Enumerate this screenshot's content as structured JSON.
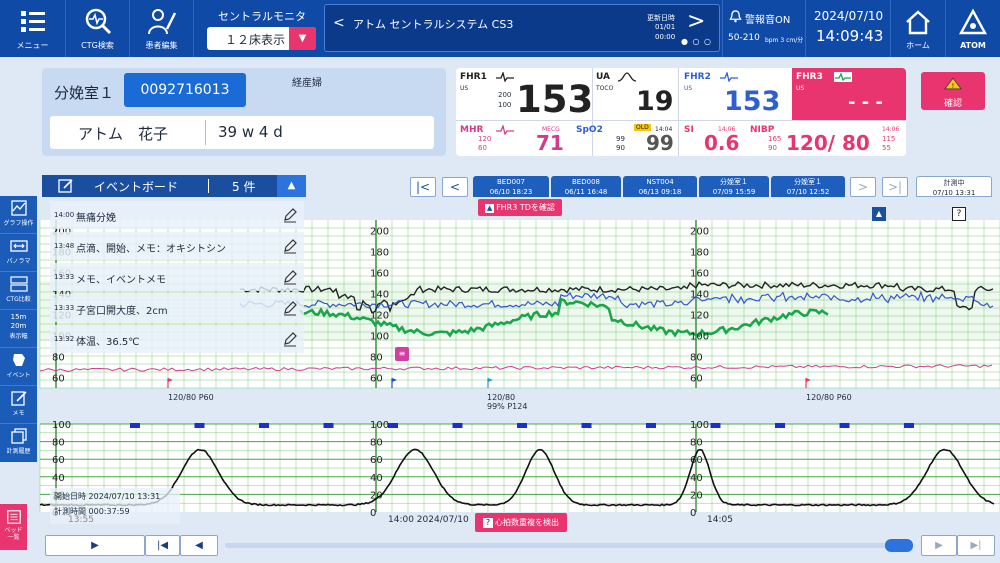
{
  "topbar": {
    "menu_label": "メニュー",
    "ctg_search_label": "CTG検索",
    "patient_edit_label": "患者編集",
    "monitor_title": "セントラルモニタ",
    "bed_display_value": "１２床表示",
    "system_title": "アトム セントラルシステム CS3",
    "update_label": "更新日時",
    "update_date": "01/01",
    "update_time": "00:00",
    "alarm_label": "警報音ON",
    "alarm_range": "50-210",
    "alarm_range_units": "bpm  3 cm/分",
    "date": "2024/07/10",
    "time": "14:09:43",
    "home_label": "ホーム",
    "logo_text": "ATOM"
  },
  "patient": {
    "room": "分娩室１",
    "id": "0092716013",
    "parity": "経産婦",
    "name": "アトム　花子",
    "gestation": "39 w 4 d"
  },
  "vitals": {
    "fhr1": {
      "label": "FHR1",
      "sub": "US",
      "high": "200",
      "low": "100",
      "value": "153"
    },
    "ua": {
      "label": "UA",
      "sub": "TOCO",
      "value": "19"
    },
    "fhr2": {
      "label": "FHR2",
      "sub": "US",
      "value": "153"
    },
    "fhr3": {
      "label": "FHR3",
      "sub": "US",
      "value": "- - -"
    },
    "confirm_label": "確認",
    "mhr": {
      "label": "MHR",
      "sub": "MECG",
      "high": "120",
      "low": "60",
      "value": "71"
    },
    "spo2": {
      "label": "SpO2",
      "badge": "OLD",
      "time": "14:04",
      "high": "99",
      "low": "90",
      "value": "99"
    },
    "si": {
      "label": "SI",
      "time": "14:06",
      "value": "0.6"
    },
    "nibp": {
      "label": "NIBP",
      "time": "14:06",
      "sys_high": "165",
      "sys_low": "90",
      "value": "120/ 80",
      "dia_high": "115",
      "dia_low": "55"
    }
  },
  "event_board": {
    "title": "イベントボード",
    "count": "5 件",
    "events": [
      {
        "time": "14:00",
        "text": "無痛分娩"
      },
      {
        "time": "13:48",
        "text": "点滴、開始、メモ：オキシトシン"
      },
      {
        "time": "13:33",
        "text": "メモ、イベントメモ"
      },
      {
        "time": "13:33",
        "text": "子宮口開大度、2cm"
      },
      {
        "time": "13:32",
        "text": "体温、36.5℃"
      }
    ]
  },
  "left_toolbar": [
    {
      "label": "グラフ操作",
      "icon": "graph-icon"
    },
    {
      "label": "パノラマ",
      "icon": "panorama-icon"
    },
    {
      "label": "CTG比較",
      "icon": "compare-icon"
    },
    {
      "label": "表示幅",
      "icon": "width-icon",
      "top": "15m",
      "bottom": "20m"
    },
    {
      "label": "イベント",
      "icon": "event-icon"
    },
    {
      "label": "メモ",
      "icon": "memo-icon"
    },
    {
      "label": "計測履歴",
      "icon": "history-icon"
    },
    {
      "label": "ベッド一覧",
      "icon": "bed-list-icon"
    }
  ],
  "tabs": [
    {
      "line1": "BED007",
      "line2": "06/10 18:23"
    },
    {
      "line1": "BED008",
      "line2": "06/11 16:48"
    },
    {
      "line1": "NST004",
      "line2": "06/13 09:18"
    },
    {
      "line1": "分娩室１",
      "line2": "07/09 15:59"
    },
    {
      "line1": "分娩室１",
      "line2": "07/10 12:52"
    },
    {
      "line1": "計測中",
      "line2": "07/10 13:31"
    }
  ],
  "chart": {
    "fhr_alert_label": "FHR3 TDを確認",
    "hr_overlap_label": "心拍数重複を検出",
    "nibp_marks": [
      "120/80 P60",
      "120/80\n99% P124",
      "120/80 P60"
    ],
    "nibp_mark_1": "120/80 P60",
    "nibp_mark_2a": "120/80",
    "nibp_mark_2b": "99% P124",
    "nibp_mark_3": "120/80 P60",
    "start_time": "開始日時 2024/07/10 13:31",
    "elapsed": "計測時間 000:37:59",
    "time_label_1": "13:55",
    "time_label_2": "14:00 2024/07/10",
    "time_label_3": "14:05",
    "fhr_scale": [
      "200",
      "180",
      "160",
      "140",
      "120",
      "100",
      "80",
      "60"
    ],
    "uc_scale": [
      "100",
      "80",
      "60",
      "40",
      "20",
      "0"
    ]
  },
  "colors": {
    "topbar": "#0f4aa6",
    "accent": "#e8356f",
    "fhr1": "#222222",
    "fhr2": "#3355cc",
    "fhr3": "#1aa64a",
    "mhr": "#d43a8c",
    "grid": "#7ccc7c"
  }
}
